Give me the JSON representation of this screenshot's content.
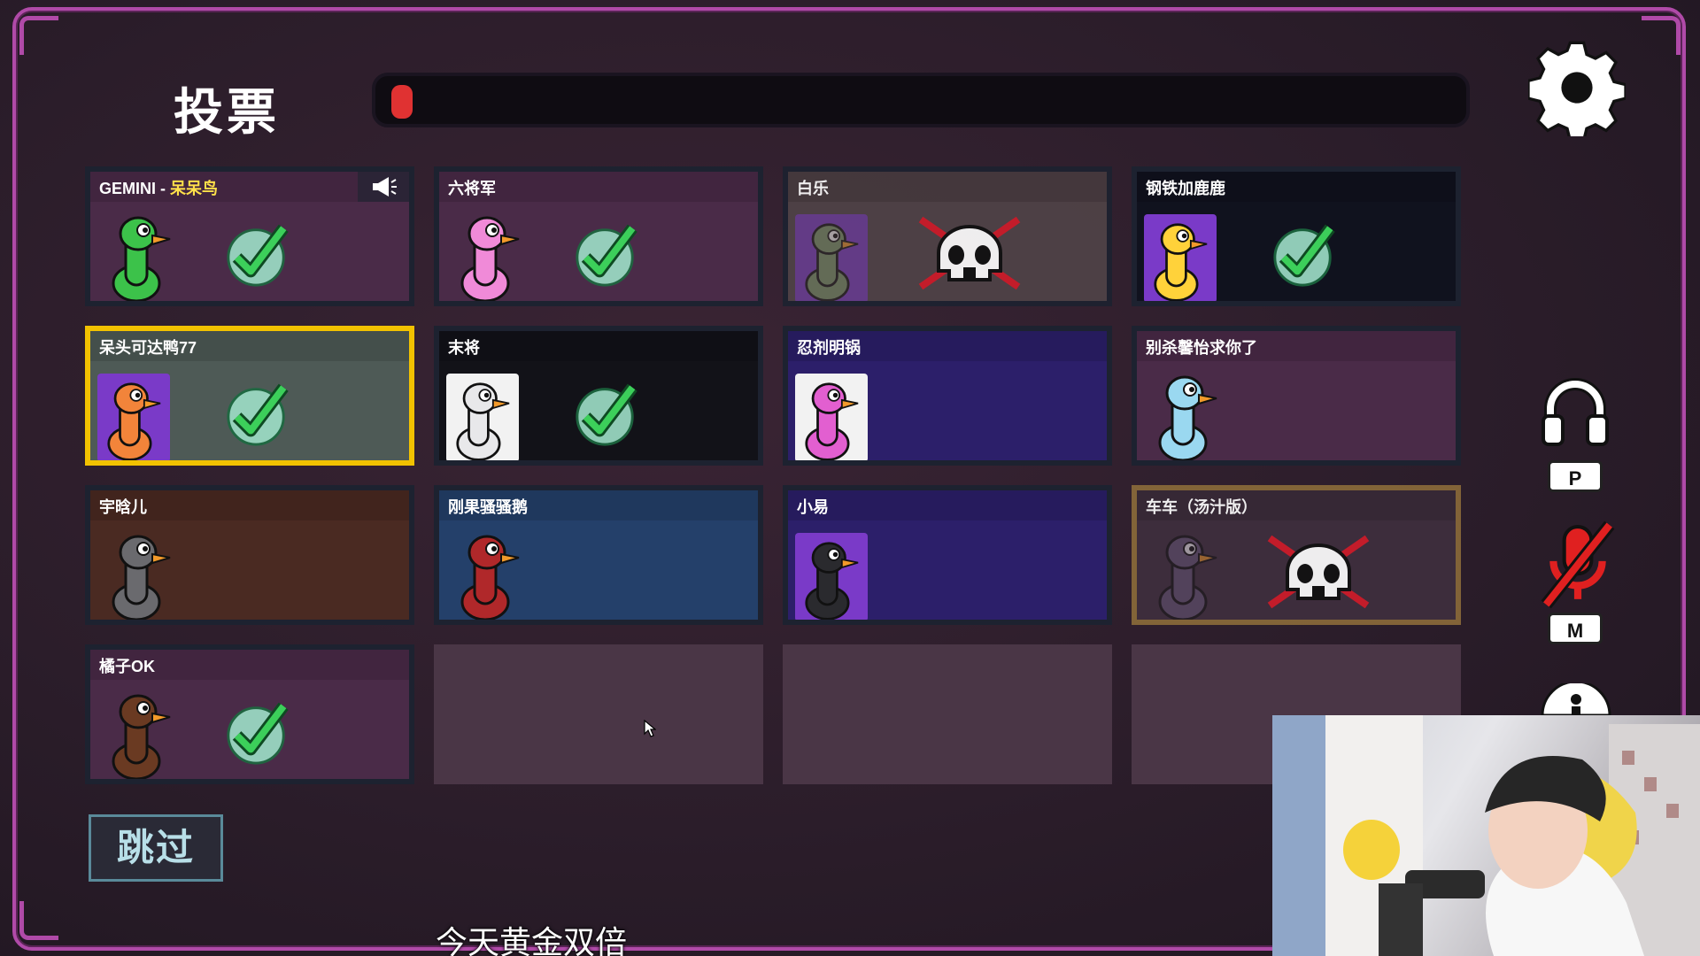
{
  "header": {
    "title": "投票"
  },
  "vote_timer": {
    "remaining_fraction": 0.02,
    "color": "#e03232"
  },
  "players": [
    {
      "name_prefix": "GEMINI - ",
      "name_highlight": "呆呆鸟",
      "voted": true,
      "speaking": true,
      "portrait": "green-goose"
    },
    {
      "name": "六将军",
      "voted": true,
      "portrait": "pink-goose-hat"
    },
    {
      "name": "白乐",
      "dead": true,
      "portrait": "zombie-goose"
    },
    {
      "name": "钢铁加鹿鹿",
      "voted": true,
      "portrait": "yellow-goose-bow"
    },
    {
      "name": "呆头可达鸭77",
      "voted": true,
      "selected": true,
      "portrait": "orange-duck"
    },
    {
      "name": "末将",
      "voted": true,
      "portrait": "suit-goose"
    },
    {
      "name": "忍剂明锅",
      "voted": false,
      "portrait": "pink-goose-card"
    },
    {
      "name": "别杀馨怡求你了",
      "voted": false,
      "portrait": "blue-goose"
    },
    {
      "name": "宇晗儿",
      "voted": false,
      "portrait": "grey-goose"
    },
    {
      "name": "刚果骚骚鹅",
      "voted": false,
      "portrait": "ushanka-goose"
    },
    {
      "name": "小易",
      "voted": false,
      "portrait": "black-goose"
    },
    {
      "name": "车车（汤汁版）",
      "dead": true,
      "ejected": true,
      "portrait": "ghost-goose"
    },
    {
      "name": "橘子OK",
      "voted": true,
      "portrait": "brown-goose-bun"
    }
  ],
  "side_controls": {
    "push_to_talk_key": "P",
    "mute_key": "M",
    "headphones_icon": "headphones-icon",
    "mic_muted_icon": "mic-muted-icon"
  },
  "skip_button": {
    "label": "跳过"
  },
  "stream_subtitle": "今天黄金双倍",
  "colors": {
    "frame": "#b04aa8",
    "selected_border": "#f2c200",
    "check": "#3ccf5a"
  }
}
